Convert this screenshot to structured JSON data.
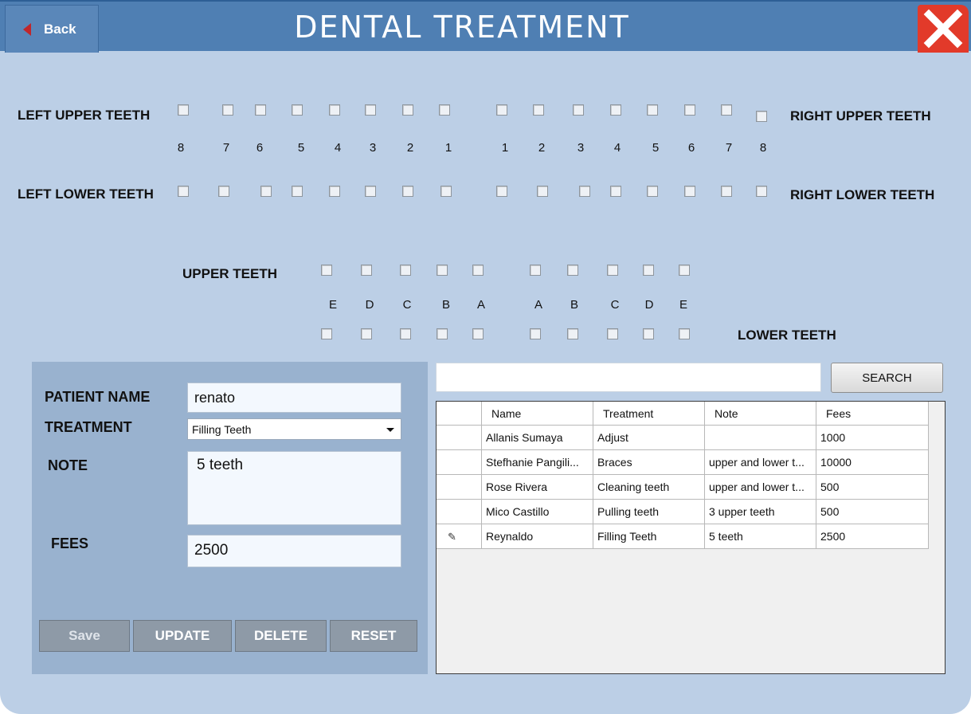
{
  "window": {
    "title": "DENTAL TREATMENT",
    "back_label": "Back"
  },
  "permanent_teeth": {
    "left_upper_label": "LEFT UPPER TEETH",
    "right_upper_label": "RIGHT UPPER TEETH",
    "left_lower_label": "LEFT LOWER TEETH",
    "right_lower_label": "RIGHT LOWER TEETH",
    "numbers": [
      "8",
      "7",
      "6",
      "5",
      "4",
      "3",
      "2",
      "1",
      "1",
      "2",
      "3",
      "4",
      "5",
      "6",
      "7",
      "8"
    ]
  },
  "primary_teeth": {
    "upper_label": "UPPER TEETH",
    "lower_label": "LOWER TEETH",
    "letters": [
      "E",
      "D",
      "C",
      "B",
      "A",
      "A",
      "B",
      "C",
      "D",
      "E"
    ]
  },
  "form": {
    "patient_name_label": "PATIENT NAME",
    "patient_name_value": "renato",
    "treatment_label": "TREATMENT",
    "treatment_value": "Filling Teeth",
    "note_label": "NOTE",
    "note_value": "5 teeth",
    "fees_label": "FEES",
    "fees_value": "2500"
  },
  "buttons": {
    "save": "Save",
    "update": "UPDATE",
    "delete": "DELETE",
    "reset": "RESET",
    "search": "SEARCH"
  },
  "search": {
    "value": ""
  },
  "table": {
    "columns": [
      "Name",
      "Treatment",
      "Note",
      "Fees"
    ],
    "rows": [
      [
        "Allanis Sumaya",
        "Adjust",
        "",
        "1000"
      ],
      [
        "Stefhanie Pangili...",
        "Braces",
        "upper and lower t...",
        "10000"
      ],
      [
        "Rose Rivera",
        "Cleaning teeth",
        "upper and lower t...",
        "500"
      ],
      [
        "Mico Castillo",
        "Pulling teeth",
        "3 upper teeth",
        "500"
      ],
      [
        "Reynaldo",
        "Filling Teeth",
        "5 teeth",
        "2500"
      ]
    ]
  },
  "colors": {
    "titlebar": "#4f7fb3",
    "background": "#bccfe6",
    "panel": "#99b2cf",
    "close": "#e23a2a",
    "back_arrow": "#c0262b"
  }
}
